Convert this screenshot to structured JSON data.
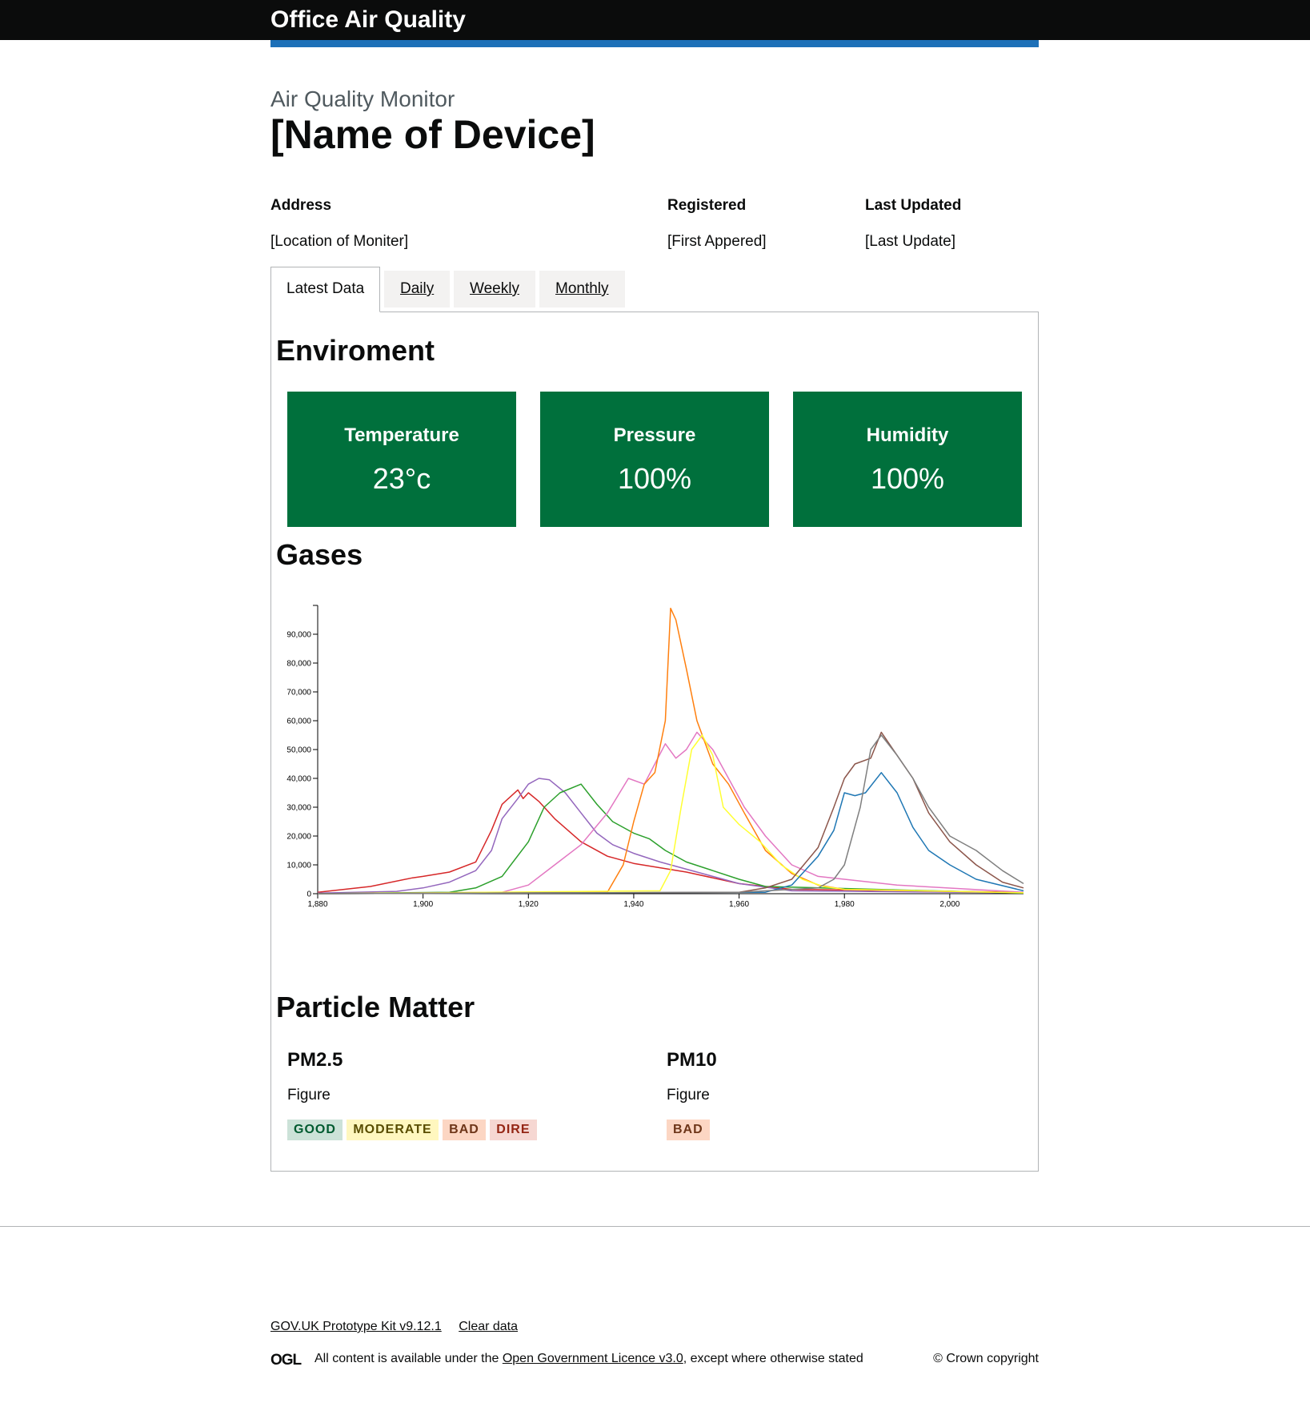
{
  "header": {
    "service_name": "Office Air Quality"
  },
  "page": {
    "caption": "Air Quality Monitor",
    "title": "[Name of Device]"
  },
  "summary": {
    "address_key": "Address",
    "address_value": "[Location of Moniter]",
    "registered_key": "Registered",
    "registered_value": "[First Appered]",
    "updated_key": "Last Updated",
    "updated_value": "[Last Update]"
  },
  "tabs": [
    {
      "label": "Latest Data",
      "selected": true
    },
    {
      "label": "Daily",
      "selected": false
    },
    {
      "label": "Weekly",
      "selected": false
    },
    {
      "label": "Monthly",
      "selected": false
    }
  ],
  "environment": {
    "heading": "Enviroment",
    "cards": [
      {
        "label": "Temperature",
        "value": "23°c"
      },
      {
        "label": "Pressure",
        "value": "100%"
      },
      {
        "label": "Humidity",
        "value": "100%"
      }
    ],
    "card_color": "#00703c"
  },
  "gases": {
    "heading": "Gases"
  },
  "chart_data": {
    "type": "line",
    "title": "",
    "xlabel": "",
    "ylabel": "",
    "xlim": [
      1880,
      2014
    ],
    "ylim": [
      0,
      100000
    ],
    "x_ticks": [
      "1,880",
      "1,900",
      "1,920",
      "1,940",
      "1,960",
      "1,980",
      "2,000"
    ],
    "y_ticks": [
      "0",
      "10,000",
      "20,000",
      "30,000",
      "40,000",
      "50,000",
      "60,000",
      "70,000",
      "80,000",
      "90,000"
    ],
    "grid": false,
    "series": [
      {
        "color": "#d62728",
        "x": [
          1880,
          1890,
          1898,
          1900,
          1905,
          1910,
          1913,
          1915,
          1918,
          1919,
          1920,
          1922,
          1925,
          1930,
          1935,
          1940,
          1945,
          1950,
          1960,
          1970,
          2014
        ],
        "y": [
          500,
          2500,
          5500,
          6000,
          7500,
          11000,
          22000,
          31000,
          36000,
          33000,
          35000,
          32000,
          26000,
          18000,
          13000,
          10500,
          9000,
          7500,
          3500,
          1500,
          500
        ]
      },
      {
        "color": "#9467bd",
        "x": [
          1880,
          1895,
          1900,
          1905,
          1910,
          1913,
          1915,
          1918,
          1920,
          1922,
          1924,
          1927,
          1930,
          1933,
          1936,
          1940,
          1945,
          1950,
          1955,
          1960,
          1970,
          2014
        ],
        "y": [
          200,
          800,
          2000,
          4000,
          8000,
          15000,
          26000,
          33000,
          38000,
          40000,
          39500,
          35000,
          28000,
          21000,
          17000,
          14000,
          11000,
          8500,
          6000,
          3500,
          1000,
          300
        ]
      },
      {
        "color": "#2ca02c",
        "x": [
          1880,
          1905,
          1910,
          1915,
          1920,
          1923,
          1926,
          1930,
          1933,
          1936,
          1940,
          1943,
          1946,
          1950,
          1955,
          1960,
          1965,
          2014
        ],
        "y": [
          0,
          500,
          2000,
          6000,
          18000,
          30000,
          35000,
          38000,
          31000,
          25000,
          21000,
          19000,
          15000,
          11000,
          8000,
          5000,
          2500,
          200
        ]
      },
      {
        "color": "#e377c2",
        "x": [
          1880,
          1915,
          1920,
          1925,
          1930,
          1935,
          1939,
          1942,
          1944,
          1946,
          1948,
          1950,
          1952,
          1955,
          1958,
          1961,
          1965,
          1970,
          1975,
          1980,
          1990,
          2014
        ],
        "y": [
          0,
          500,
          3000,
          10000,
          17000,
          28000,
          40000,
          38000,
          45000,
          52000,
          47000,
          50000,
          56000,
          50000,
          40000,
          30000,
          20000,
          10000,
          6000,
          5000,
          3000,
          500
        ]
      },
      {
        "color": "#ff7f0e",
        "x": [
          1880,
          1935,
          1938,
          1940,
          1942,
          1944,
          1946,
          1947,
          1948,
          1950,
          1952,
          1955,
          1958,
          1961,
          1965,
          1970,
          1975,
          1980,
          2014
        ],
        "y": [
          0,
          500,
          10000,
          25000,
          38000,
          42000,
          60000,
          99000,
          95000,
          78000,
          60000,
          45000,
          38000,
          28000,
          15000,
          7000,
          3000,
          1500,
          300
        ]
      },
      {
        "color": "#ffff33",
        "x": [
          1880,
          1945,
          1947,
          1949,
          1951,
          1953,
          1955,
          1957,
          1960,
          1964,
          1968,
          1972,
          1976,
          1980,
          2014
        ],
        "y": [
          0,
          1000,
          8000,
          30000,
          50000,
          55000,
          48000,
          30000,
          24000,
          18000,
          10000,
          5000,
          2500,
          1500,
          300
        ]
      },
      {
        "color": "#1f77b4",
        "x": [
          1880,
          1965,
          1970,
          1975,
          1978,
          1980,
          1982,
          1984,
          1987,
          1990,
          1993,
          1996,
          2000,
          2005,
          2014
        ],
        "y": [
          0,
          500,
          3000,
          13000,
          22000,
          35000,
          34000,
          35000,
          42000,
          35000,
          23000,
          15000,
          10000,
          5000,
          1000
        ]
      },
      {
        "color": "#8c564b",
        "x": [
          1880,
          1960,
          1965,
          1970,
          1975,
          1978,
          1980,
          1982,
          1985,
          1987,
          1990,
          1993,
          1996,
          2000,
          2005,
          2010,
          2014
        ],
        "y": [
          0,
          500,
          2000,
          5000,
          16000,
          30000,
          40000,
          45000,
          47000,
          56000,
          48000,
          40000,
          28000,
          18000,
          10000,
          4000,
          2000
        ]
      },
      {
        "color": "#7f7f7f",
        "x": [
          1880,
          1960,
          1975,
          1978,
          1980,
          1983,
          1985,
          1987,
          1990,
          1993,
          1996,
          2000,
          2005,
          2010,
          2014
        ],
        "y": [
          0,
          500,
          2000,
          5000,
          10000,
          30000,
          50000,
          55000,
          48000,
          40000,
          30000,
          20000,
          15000,
          8000,
          3500
        ]
      }
    ]
  },
  "particles": {
    "heading": "Particle Matter",
    "pm25": {
      "title": "PM2.5",
      "figure": "Figure",
      "tags": [
        "GOOD",
        "MODERATE",
        "BAD",
        "DIRE"
      ]
    },
    "pm10": {
      "title": "PM10",
      "figure": "Figure",
      "tag": "BAD"
    }
  },
  "footer": {
    "kit_link": "GOV.UK Prototype Kit v9.12.1",
    "clear_link": "Clear data",
    "licence_prefix": "All content is available under the",
    "licence_link": "Open Government Licence v3.0",
    "licence_suffix": ", except where otherwise stated",
    "copyright": "© Crown copyright",
    "ogl_logo": "OGL"
  }
}
